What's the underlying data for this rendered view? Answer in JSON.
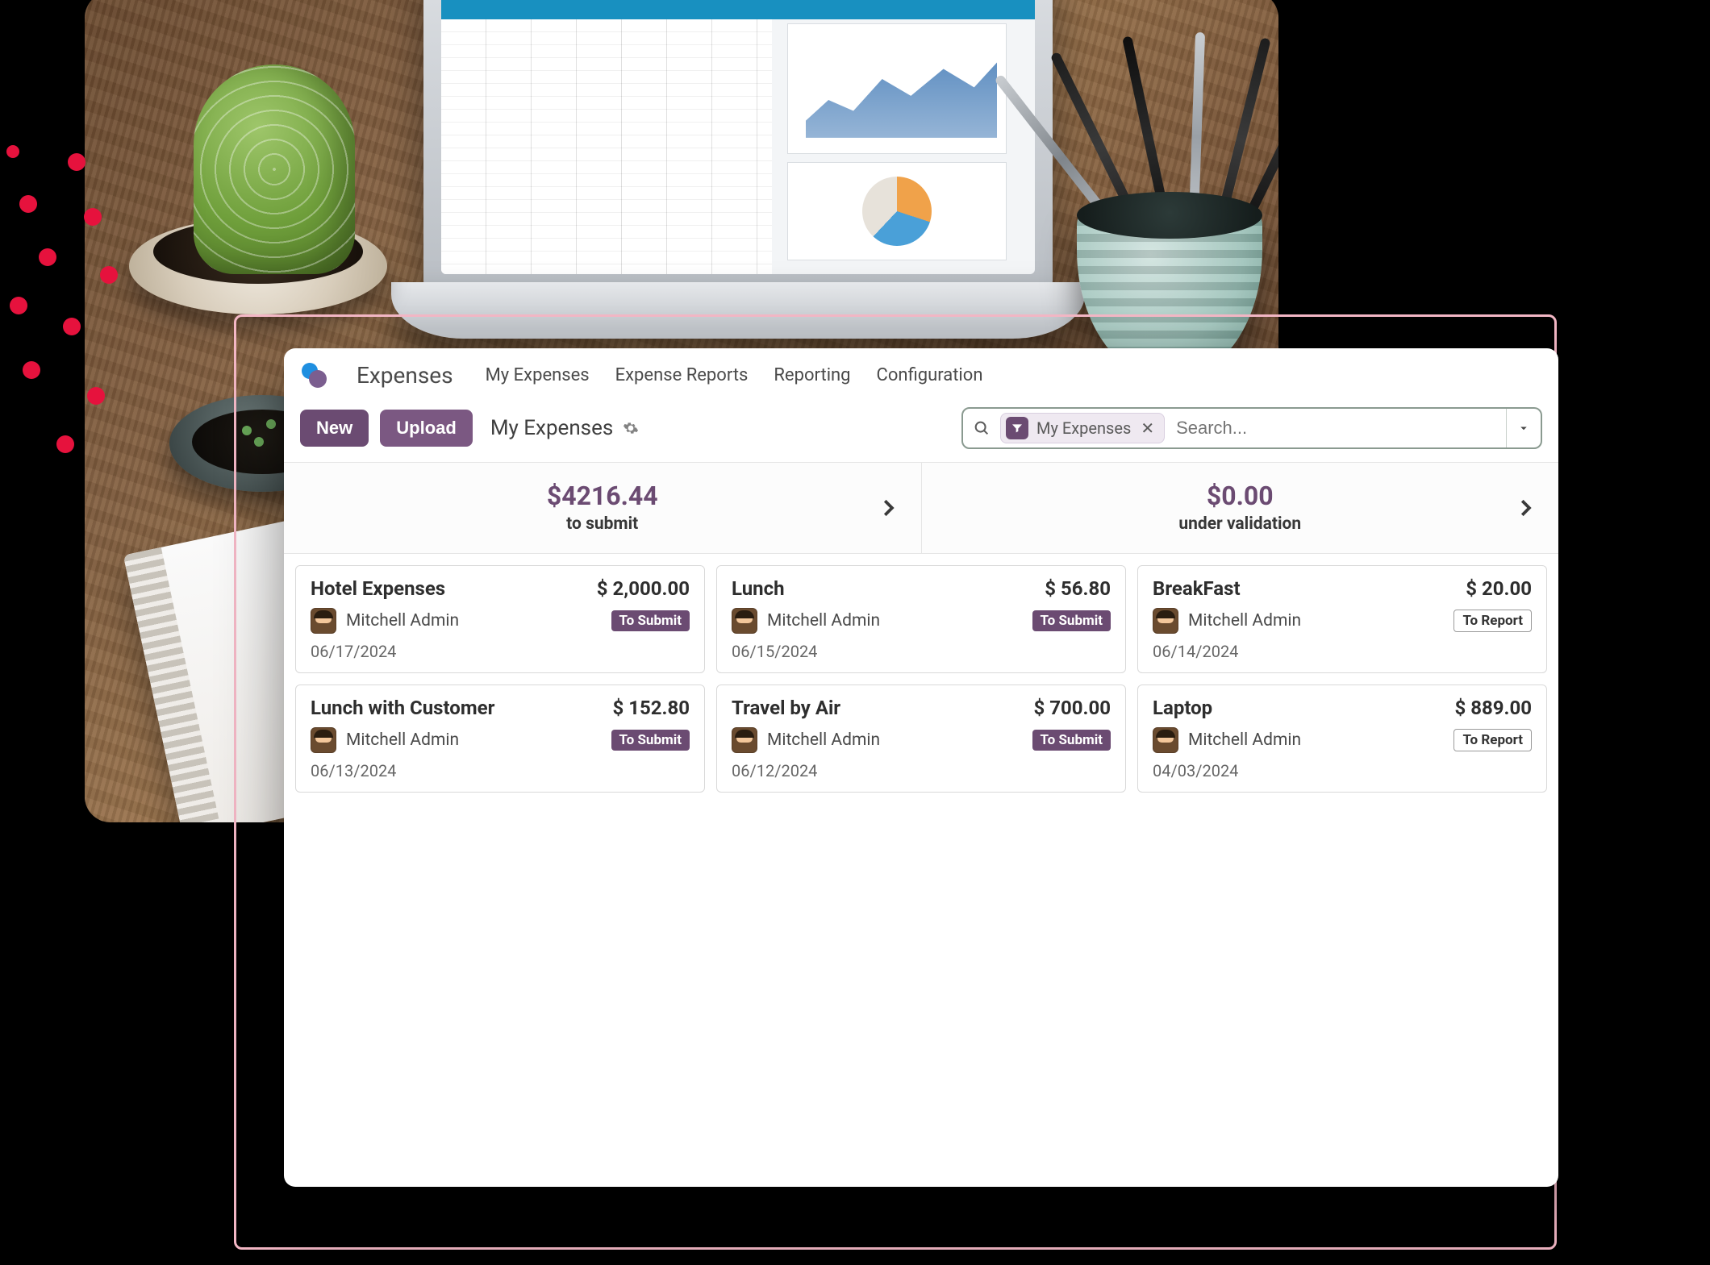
{
  "app": {
    "title": "Expenses",
    "menu": [
      "My Expenses",
      "Expense Reports",
      "Reporting",
      "Configuration"
    ]
  },
  "toolbar": {
    "new_label": "New",
    "upload_label": "Upload",
    "breadcrumb": "My Expenses"
  },
  "search": {
    "chip_label": "My Expenses",
    "placeholder": "Search..."
  },
  "summary": [
    {
      "amount": "$4216.44",
      "label": "to submit"
    },
    {
      "amount": "$0.00",
      "label": "under validation"
    }
  ],
  "status_labels": {
    "submit": "To Submit",
    "report": "To Report"
  },
  "expenses": [
    {
      "title": "Hotel Expenses",
      "amount": "$ 2,000.00",
      "person": "Mitchell Admin",
      "status": "submit",
      "date": "06/17/2024"
    },
    {
      "title": "Lunch",
      "amount": "$ 56.80",
      "person": "Mitchell Admin",
      "status": "submit",
      "date": "06/15/2024"
    },
    {
      "title": "BreakFast",
      "amount": "$ 20.00",
      "person": "Mitchell Admin",
      "status": "report",
      "date": "06/14/2024"
    },
    {
      "title": "Lunch with Customer",
      "amount": "$ 152.80",
      "person": "Mitchell Admin",
      "status": "submit",
      "date": "06/13/2024"
    },
    {
      "title": "Travel by Air",
      "amount": "$ 700.00",
      "person": "Mitchell Admin",
      "status": "submit",
      "date": "06/12/2024"
    },
    {
      "title": "Laptop",
      "amount": "$ 889.00",
      "person": "Mitchell Admin",
      "status": "report",
      "date": "04/03/2024"
    }
  ],
  "colors": {
    "brand": "#6b4b72",
    "accent_dot": "#e6123d",
    "outline_pink": "#f4b8c6"
  }
}
